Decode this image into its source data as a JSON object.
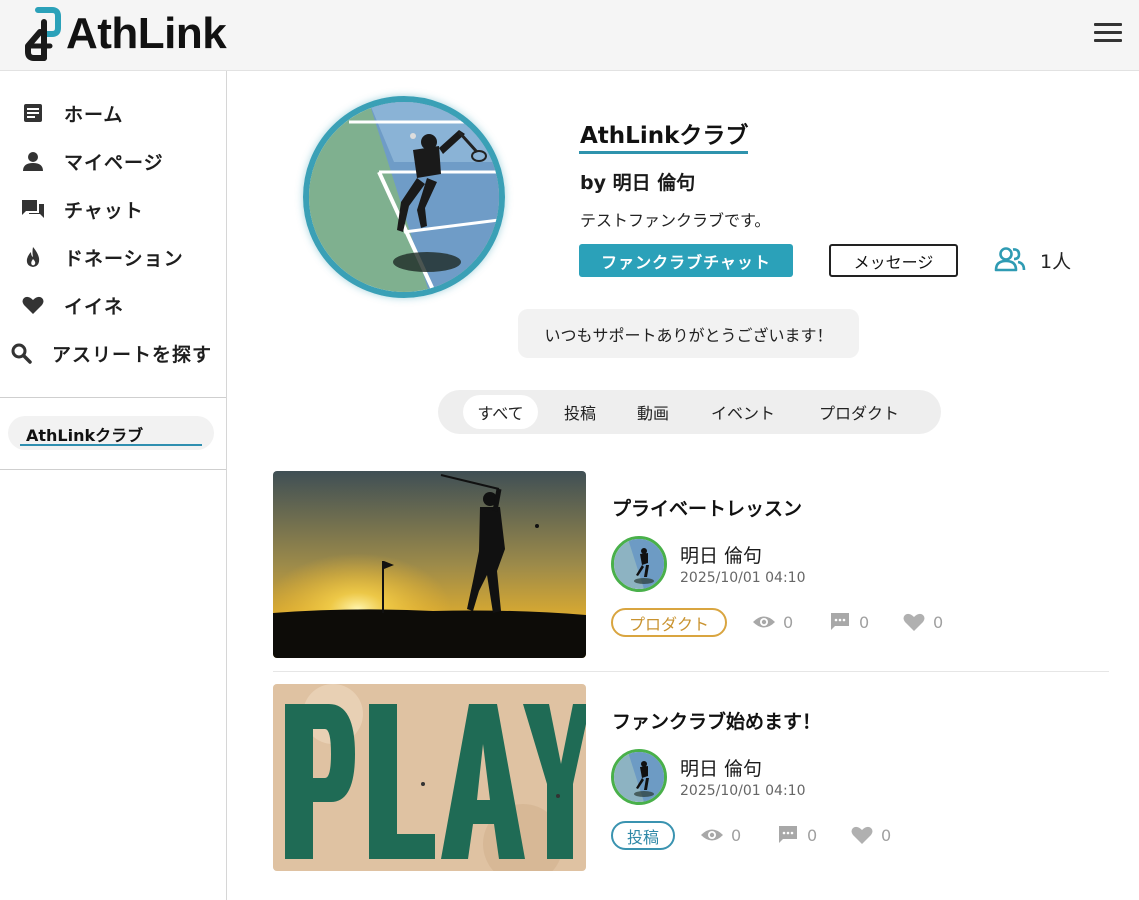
{
  "header": {
    "logo_text": "AthLink",
    "menu_icon": "hamburger-menu-icon"
  },
  "sidebar": {
    "items": [
      {
        "label": "ホーム",
        "icon": "article-icon"
      },
      {
        "label": "マイページ",
        "icon": "person-icon"
      },
      {
        "label": "チャット",
        "icon": "chat-icon"
      },
      {
        "label": "ドネーション",
        "icon": "flame-icon"
      },
      {
        "label": "イイネ",
        "icon": "heart-icon"
      },
      {
        "label": "アスリートを探す",
        "icon": "search-icon"
      }
    ],
    "club_link": "AthLinkクラブ"
  },
  "profile": {
    "club_name": "AthLinkクラブ",
    "owner": "by 明日 倫句",
    "description": "テストファンクラブです。",
    "chat_button": "ファンクラブチャット",
    "message_button": "メッセージ",
    "member_count": "1人",
    "bubble_message": "いつもサポートありがとうございます！"
  },
  "tabs": [
    "すべて",
    "投稿",
    "動画",
    "イベント",
    "プロダクト"
  ],
  "active_tab": "すべて",
  "posts": [
    {
      "title": "プライベートレッスン",
      "author": "明日 倫句",
      "date": "2025/10/01 04:10",
      "tag": "プロダクト",
      "views": "0",
      "comments": "0",
      "likes": "0",
      "thumbnail": "golfer-sunset-image"
    },
    {
      "title": "ファンクラブ始めます！",
      "author": "明日 倫句",
      "date": "2025/10/01 04:10",
      "tag": "投稿",
      "views": "0",
      "comments": "0",
      "likes": "0",
      "thumbnail": "play-sign-image"
    }
  ],
  "colors": {
    "accent": "#2ba1b9",
    "product_tag": "#d9a540",
    "post_tag": "#3a93b0",
    "avatar_ring": "#49b04a",
    "stat_gray": "#a0a0a0"
  }
}
